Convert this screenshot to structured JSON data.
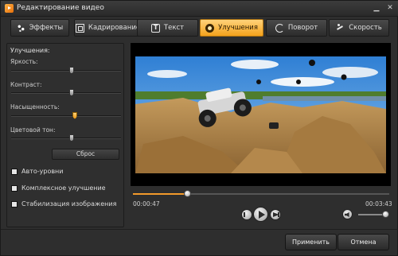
{
  "window": {
    "title": "Редактирование видео"
  },
  "titlebar": {
    "minimize_glyph": "▁",
    "close_glyph": "✕"
  },
  "tabs": [
    {
      "label": "Эффекты",
      "icon": "effects-icon",
      "active": false
    },
    {
      "label": "Кадрирование",
      "icon": "crop-icon",
      "active": false
    },
    {
      "label": "Текст",
      "icon": "text-icon",
      "active": false
    },
    {
      "label": "Улучшения",
      "icon": "enhance-icon",
      "active": true
    },
    {
      "label": "Поворот",
      "icon": "rotate-icon",
      "active": false
    },
    {
      "label": "Скорость",
      "icon": "speed-icon",
      "active": false
    }
  ],
  "enhance": {
    "title": "Улучшения:",
    "sliders": [
      {
        "label": "Яркость:",
        "value": 0.55,
        "accent": false
      },
      {
        "label": "Контраст:",
        "value": 0.55,
        "accent": false
      },
      {
        "label": "Насыщенность:",
        "value": 0.58,
        "accent": true
      },
      {
        "label": "Цветовой тон:",
        "value": 0.55,
        "accent": false
      }
    ],
    "reset_label": "Сброс",
    "checkboxes": [
      {
        "label": "Авто-уровни",
        "checked": false
      },
      {
        "label": "Комплексное улучшение",
        "checked": false
      },
      {
        "label": "Стабилизация изображения",
        "checked": false
      }
    ]
  },
  "player": {
    "current_time": "00:00:47",
    "total_time": "00:03:43",
    "progress": 0.21,
    "volume": 0.9
  },
  "footer": {
    "apply_label": "Применить",
    "cancel_label": "Отмена"
  },
  "colors": {
    "accent": "#f4a21c",
    "progress": "#f39a2b",
    "background": "#2e2e2e"
  }
}
